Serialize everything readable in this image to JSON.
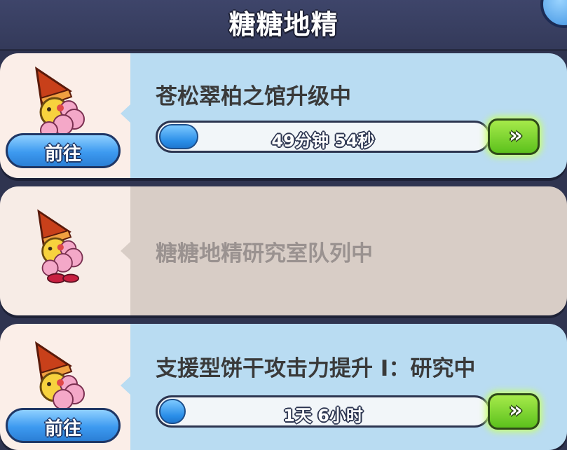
{
  "header": {
    "title": "糖糖地精"
  },
  "tasks": [
    {
      "title": "苍松翠柏之馆升级中",
      "progress_text": "49分钟 54秒",
      "progress": 0.12,
      "goto_label": "前往",
      "speedup_label": "»",
      "icon": "gnome-icon"
    },
    {
      "title": "糖糖地精研究室队列中",
      "icon": "gnome-icon",
      "state": "idle"
    },
    {
      "title": "支援型饼干攻击力提升 Ⅰ：研究中",
      "progress_text": "1天 6小时",
      "progress": 0.06,
      "goto_label": "前往",
      "speedup_label": "»",
      "icon": "gnome-icon"
    }
  ],
  "colors": {
    "active_panel": "#b9dcf2",
    "idle_panel": "#d8cdc6",
    "progress_fill": "#2a8ee8",
    "speedup": "#5cc11d"
  }
}
